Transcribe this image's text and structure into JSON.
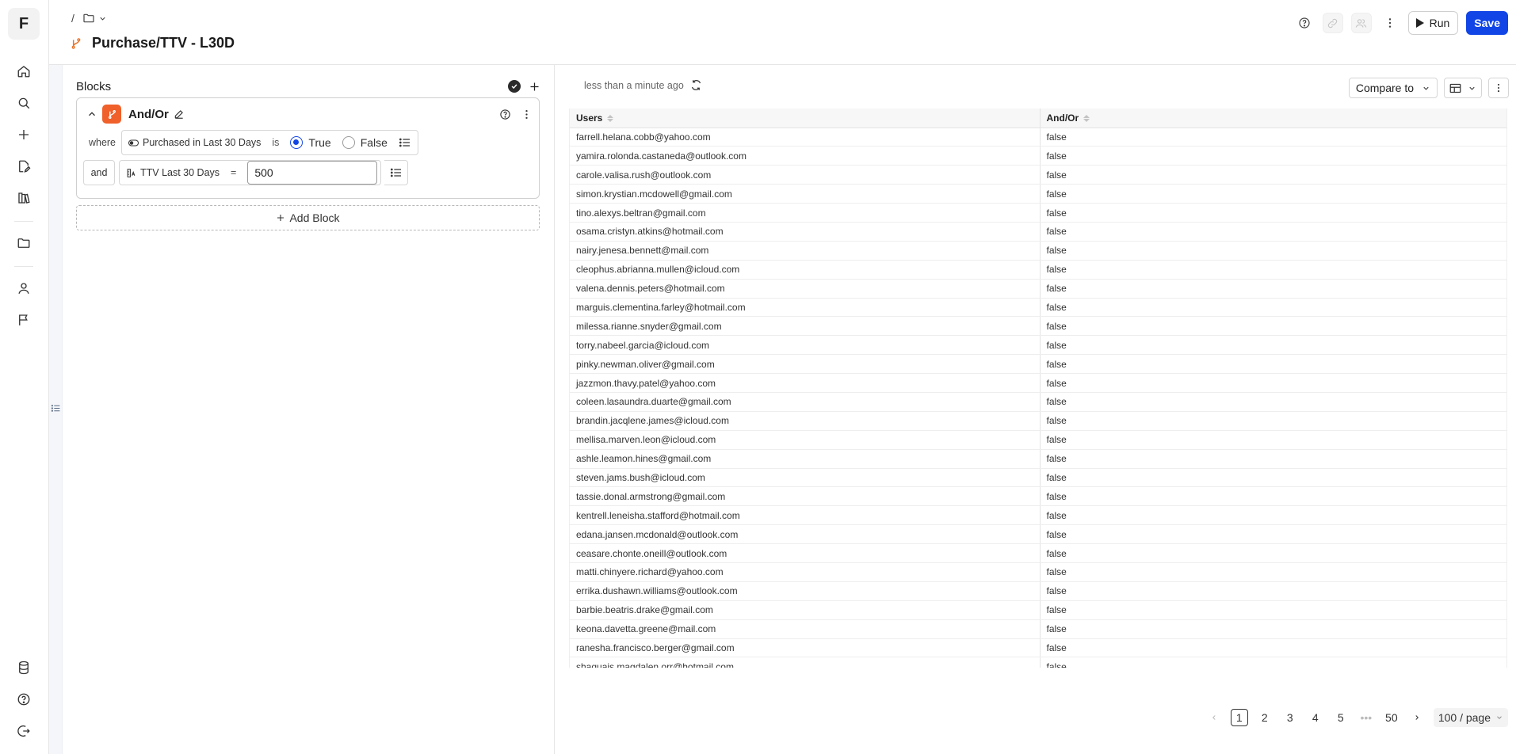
{
  "app": {
    "logo_letter": "F"
  },
  "header": {
    "breadcrumb_sep": "/",
    "title": "Purchase/TTV - L30D",
    "run_label": "Run",
    "save_label": "Save"
  },
  "blocks": {
    "heading": "Blocks",
    "card": {
      "title": "And/Or",
      "conditions": [
        {
          "keyword": "where",
          "field": "Purchased in Last 30 Days",
          "operator": "is",
          "options": [
            "True",
            "False"
          ],
          "selected": "True"
        },
        {
          "keyword": "and",
          "field": "TTV Last 30 Days",
          "operator": "=",
          "value": "500"
        }
      ]
    },
    "add_label": "Add Block"
  },
  "results": {
    "status": "less than a minute ago",
    "compare_label": "Compare to",
    "columns": [
      "Users",
      "And/Or"
    ],
    "rows": [
      [
        "farrell.helana.cobb@yahoo.com",
        "false"
      ],
      [
        "yamira.rolonda.castaneda@outlook.com",
        "false"
      ],
      [
        "carole.valisa.rush@outlook.com",
        "false"
      ],
      [
        "simon.krystian.mcdowell@gmail.com",
        "false"
      ],
      [
        "tino.alexys.beltran@gmail.com",
        "false"
      ],
      [
        "osama.cristyn.atkins@hotmail.com",
        "false"
      ],
      [
        "nairy.jenesa.bennett@mail.com",
        "false"
      ],
      [
        "cleophus.abrianna.mullen@icloud.com",
        "false"
      ],
      [
        "valena.dennis.peters@hotmail.com",
        "false"
      ],
      [
        "marguis.clementina.farley@hotmail.com",
        "false"
      ],
      [
        "milessa.rianne.snyder@gmail.com",
        "false"
      ],
      [
        "torry.nabeel.garcia@icloud.com",
        "false"
      ],
      [
        "pinky.newman.oliver@gmail.com",
        "false"
      ],
      [
        "jazzmon.thavy.patel@yahoo.com",
        "false"
      ],
      [
        "coleen.lasaundra.duarte@gmail.com",
        "false"
      ],
      [
        "brandin.jacqlene.james@icloud.com",
        "false"
      ],
      [
        "mellisa.marven.leon@icloud.com",
        "false"
      ],
      [
        "ashle.leamon.hines@gmail.com",
        "false"
      ],
      [
        "steven.jams.bush@icloud.com",
        "false"
      ],
      [
        "tassie.donal.armstrong@gmail.com",
        "false"
      ],
      [
        "kentrell.leneisha.stafford@hotmail.com",
        "false"
      ],
      [
        "edana.jansen.mcdonald@outlook.com",
        "false"
      ],
      [
        "ceasare.chonte.oneill@outlook.com",
        "false"
      ],
      [
        "matti.chinyere.richard@yahoo.com",
        "false"
      ],
      [
        "errika.dushawn.williams@outlook.com",
        "false"
      ],
      [
        "barbie.beatris.drake@gmail.com",
        "false"
      ],
      [
        "keona.davetta.greene@mail.com",
        "false"
      ],
      [
        "ranesha.francisco.berger@gmail.com",
        "false"
      ],
      [
        "shaquais.magdalen.orr@hotmail.com",
        "false"
      ]
    ],
    "pagination": {
      "pages": [
        "1",
        "2",
        "3",
        "4",
        "5"
      ],
      "ellipsis": "•••",
      "last": "50",
      "current": "1",
      "page_size": "100 / page"
    }
  },
  "colors": {
    "accent": "#1145e6",
    "block_badge": "#f0602a"
  },
  "icons": {
    "rail": [
      "home-icon",
      "search-icon",
      "plus-icon",
      "edit-file-icon",
      "books-icon",
      "folder-icon",
      "user-icon",
      "flag-icon",
      "database-icon",
      "help-icon",
      "logout-icon"
    ]
  }
}
